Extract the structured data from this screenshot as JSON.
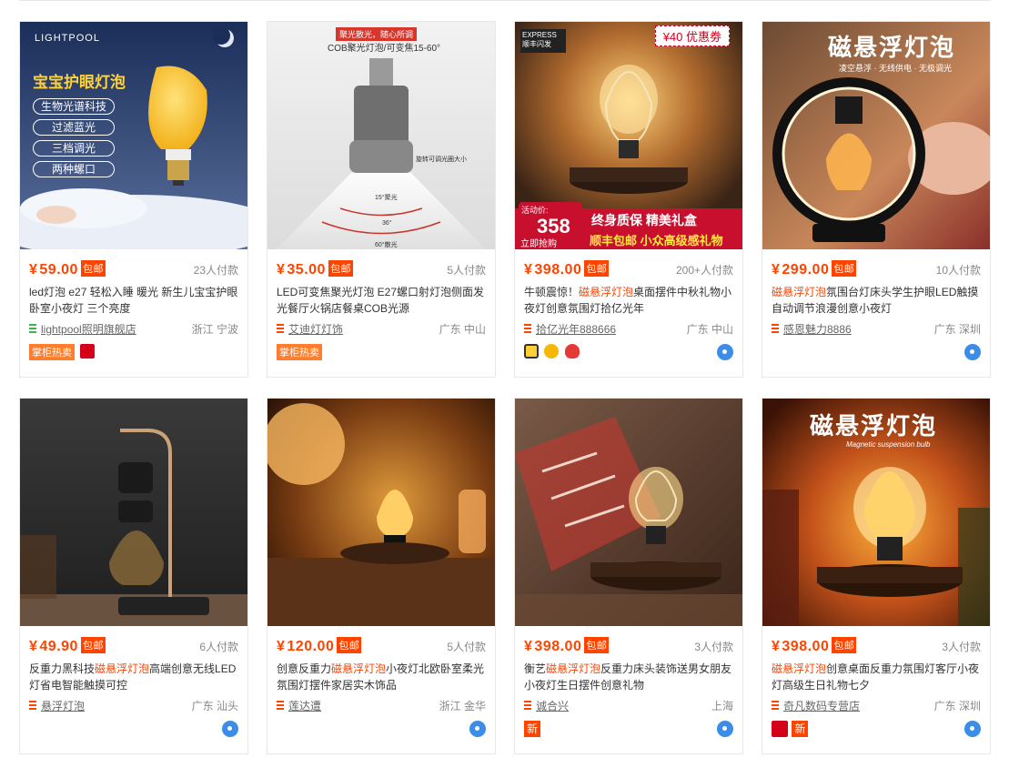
{
  "colors": {
    "accent": "#ff4400",
    "hot_tag": "#ff7e2d",
    "border": "#e8e8e8",
    "wangwang": "#3b8de8"
  },
  "icons": {
    "shop": "shop-lines-icon",
    "wangwang": "wangwang-chat-icon"
  },
  "products": [
    {
      "price": "59.00",
      "yen": "¥",
      "baoyou": "包邮",
      "sales": "23人付款",
      "title": "led灯泡 e27 轻松入睡 暖光 新生儿宝宝护眼卧室小夜灯 三个亮度",
      "title_hl": "",
      "shop": "lightpool照明旗舰店",
      "location": "浙江 宁波",
      "tags": [
        "掌柜热卖"
      ],
      "image": {
        "brand": "LIGHTPOOL",
        "headline": "宝宝护眼灯泡",
        "features": [
          "生物光谱科技",
          "过滤蓝光",
          "三档调光",
          "两种螺口"
        ]
      }
    },
    {
      "price": "35.00",
      "yen": "¥",
      "baoyou": "包邮",
      "sales": "5人付款",
      "title": "LED可变焦聚光灯泡 E27螺口射灯泡侧面发光餐厅火锅店餐桌COB光源",
      "title_hl": "",
      "shop": "艾迪灯灯饰",
      "location": "广东 中山",
      "tags": [
        "掌柜热卖"
      ],
      "image": {
        "banner": "聚光散光，随心所调",
        "headline": "COB聚光灯泡/可变焦15-60°",
        "note": "旋转可调光圈大小",
        "angles": [
          "15°聚光",
          "36°",
          "60°散光"
        ]
      }
    },
    {
      "price": "398.00",
      "yen": "¥",
      "baoyou": "包邮",
      "sales": "200+人付款",
      "title_a": "牛顿震惊！",
      "title_hl": "磁悬浮灯泡",
      "title_b": "桌面摆件中秋礼物小夜灯创意氛围灯拾亿光年",
      "shop": "拾亿光年888666",
      "location": "广东 中山",
      "tags": [],
      "image": {
        "express": "EXPRESS",
        "express_sub": "顺丰闪发",
        "coupon": "¥40 优惠劵",
        "promo_label": "活动价:",
        "promo_price": "358",
        "promo_sub": "立即抢购",
        "slogan": "终身质保 精美礼盒",
        "slogan2": "顺丰包邮 小众高级感礼物"
      }
    },
    {
      "price": "299.00",
      "yen": "¥",
      "baoyou": "包邮",
      "sales": "10人付款",
      "title_a": "",
      "title_hl": "磁悬浮灯泡",
      "title_b": "氛围台灯床头学生护眼LED触摸自动调节浪漫创意小夜灯",
      "shop": "感恩魅力8886",
      "location": "广东 深圳",
      "tags": [],
      "image": {
        "headline": "磁悬浮灯泡",
        "sub": "凌空悬浮 · 无线供电 · 无极调光"
      }
    },
    {
      "price": "49.90",
      "yen": "¥",
      "baoyou": "包邮",
      "sales": "6人付款",
      "title_a": "反重力黑科技",
      "title_hl": "磁悬浮灯泡",
      "title_b": "高端创意无线LED灯省电智能触摸可控",
      "shop": "悬浮灯泡",
      "location": "广东 汕头",
      "tags": []
    },
    {
      "price": "120.00",
      "yen": "¥",
      "baoyou": "包邮",
      "sales": "5人付款",
      "title_a": "创意反重力",
      "title_hl": "磁悬浮灯泡",
      "title_b": "小夜灯北欧卧室柔光氛围灯摆件家居实木饰品",
      "shop": "莲达遭",
      "location": "浙江 金华",
      "tags": []
    },
    {
      "price": "398.00",
      "yen": "¥",
      "baoyou": "包邮",
      "sales": "3人付款",
      "title_a": "衡艺",
      "title_hl": "磁悬浮灯泡",
      "title_b": "反重力床头装饰送男女朋友小夜灯生日摆件创意礼物",
      "shop": "诚合兴",
      "location": "上海",
      "tags": [
        "新"
      ]
    },
    {
      "price": "398.00",
      "yen": "¥",
      "baoyou": "包邮",
      "sales": "3人付款",
      "title_a": "",
      "title_hl": "磁悬浮灯泡",
      "title_b": "创意桌面反重力氛围灯客厅小夜灯高级生日礼物七夕",
      "shop": "奇凡数码专营店",
      "location": "广东 深圳",
      "tags": [
        "新"
      ],
      "image": {
        "headline": "磁悬浮灯泡",
        "sub": "Magnetic suspension bulb"
      }
    }
  ]
}
